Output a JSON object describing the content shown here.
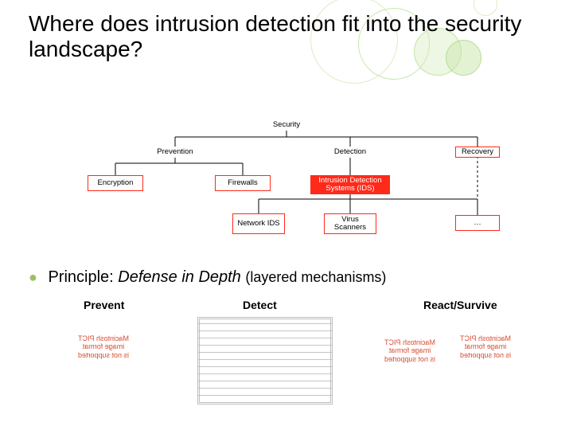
{
  "title": "Where does intrusion detection fit into the security landscape?",
  "diagram": {
    "root": "Security",
    "level1": {
      "prevention": "Prevention",
      "detection": "Detection",
      "recovery": "Recovery"
    },
    "level2": {
      "encryption": "Encryption",
      "firewalls": "Firewalls",
      "ids": "Intrusion Detection Systems (IDS)"
    },
    "level3": {
      "nids": "Network IDS",
      "virus": "Virus Scanners",
      "etc": "…"
    }
  },
  "principle_line": {
    "lead": "Principle:",
    "italic": "Defense in Depth",
    "rest": "(layered mechanisms)"
  },
  "bottom_labels": {
    "prevent": "Prevent",
    "detect": "Detect",
    "react": "React/Survive"
  },
  "pict_error": {
    "l1": "Macintosh PICT",
    "l2": "image format",
    "l3": "is not supported"
  }
}
